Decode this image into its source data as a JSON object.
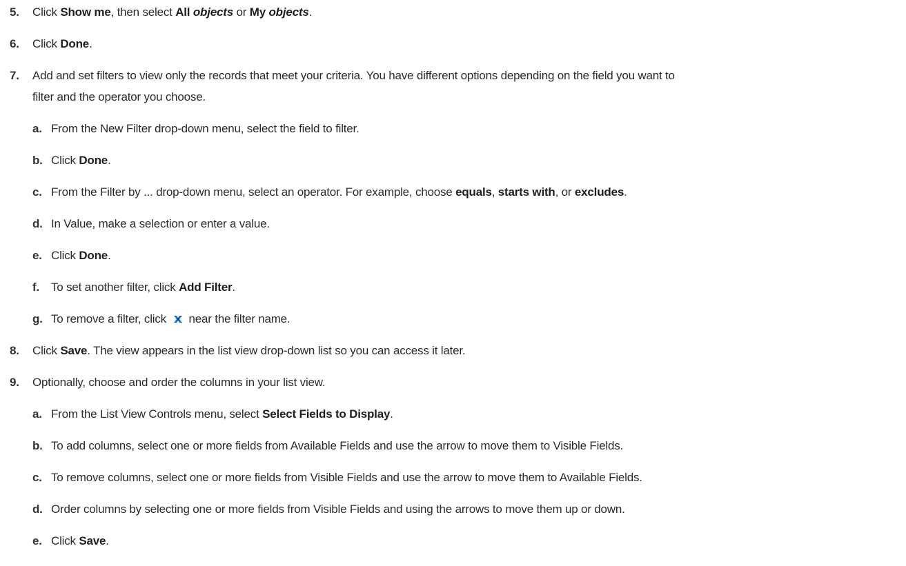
{
  "steps": [
    {
      "num": "5.",
      "parts": [
        "Click ",
        "Show me",
        ", then select ",
        "All ",
        "objects",
        " or ",
        "My ",
        "objects",
        "."
      ]
    },
    {
      "num": "6.",
      "parts": [
        "Click ",
        "Done",
        "."
      ]
    },
    {
      "num": "7.",
      "line1": "Add and set filters to view only the records that meet your criteria. You have different options depending on the field you want to",
      "line2": "filter and the operator you choose."
    },
    {
      "num": "a.",
      "text": "From the New Filter drop-down menu, select the field to filter."
    },
    {
      "num": "b.",
      "parts": [
        "Click ",
        "Done",
        "."
      ]
    },
    {
      "num": "c.",
      "parts": [
        "From the Filter by ... drop-down menu, select an operator. For example, choose ",
        "equals",
        ", ",
        "starts with",
        ", or ",
        "excludes",
        "."
      ]
    },
    {
      "num": "d.",
      "text": "In Value, make a selection or enter a value."
    },
    {
      "num": "e.",
      "parts": [
        "Click ",
        "Done",
        "."
      ]
    },
    {
      "num": "f.",
      "parts": [
        "To set another filter, click ",
        "Add Filter",
        "."
      ]
    },
    {
      "num": "g.",
      "parts": [
        "To remove a filter, click ",
        "near the filter name."
      ]
    },
    {
      "num": "8.",
      "parts": [
        "Click ",
        "Save",
        ". The view appears in the list view drop-down list so you can access it later."
      ]
    },
    {
      "num": "9.",
      "text": "Optionally, choose and order the columns in your list view."
    },
    {
      "num": "a.",
      "parts": [
        "From the List View Controls menu, select ",
        "Select Fields to Display",
        "."
      ]
    },
    {
      "num": "b.",
      "text": "To add columns, select one or more fields from Available Fields and use the arrow to move them to Visible Fields."
    },
    {
      "num": "c.",
      "text": "To remove columns, select one or more fields from Visible Fields and use the arrow to move them to Available Fields."
    },
    {
      "num": "d.",
      "text": "Order columns by selecting one or more fields from Visible Fields and using the arrows to move them up or down."
    },
    {
      "num": "e.",
      "parts": [
        "Click ",
        "Save",
        "."
      ]
    }
  ],
  "icons": {
    "remove_filter": "remove-filter-x-icon",
    "icon_color": "#1f6fc5"
  }
}
